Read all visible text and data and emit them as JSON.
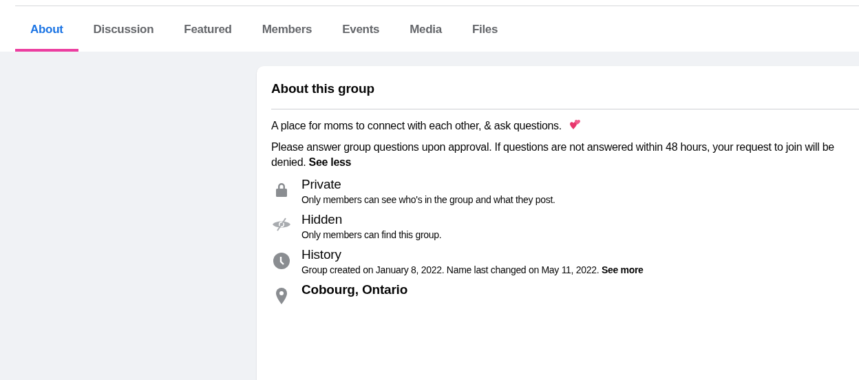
{
  "tabs": [
    {
      "label": "About",
      "selected": true
    },
    {
      "label": "Discussion",
      "selected": false
    },
    {
      "label": "Featured",
      "selected": false
    },
    {
      "label": "Members",
      "selected": false
    },
    {
      "label": "Events",
      "selected": false
    },
    {
      "label": "Media",
      "selected": false
    },
    {
      "label": "Files",
      "selected": false
    }
  ],
  "about_card": {
    "title": "About this group",
    "description": "A place for moms to connect with each other, & ask questions.",
    "rules": {
      "text": "Please answer group questions upon approval. If questions are not answered within 48 hours, your request to join will be denied.",
      "link": "See less"
    },
    "items": [
      {
        "kind": "private",
        "title": "Private",
        "text": "Only members can see who's in the group and what they post."
      },
      {
        "kind": "hidden",
        "title": "Hidden",
        "text": "Only members can find this group."
      },
      {
        "kind": "history",
        "title": "History",
        "text": "Group created on January 8, 2022. Name last changed on May 11, 2022.",
        "link": "See more"
      },
      {
        "kind": "location",
        "title": "Cobourg, Ontario"
      }
    ]
  }
}
